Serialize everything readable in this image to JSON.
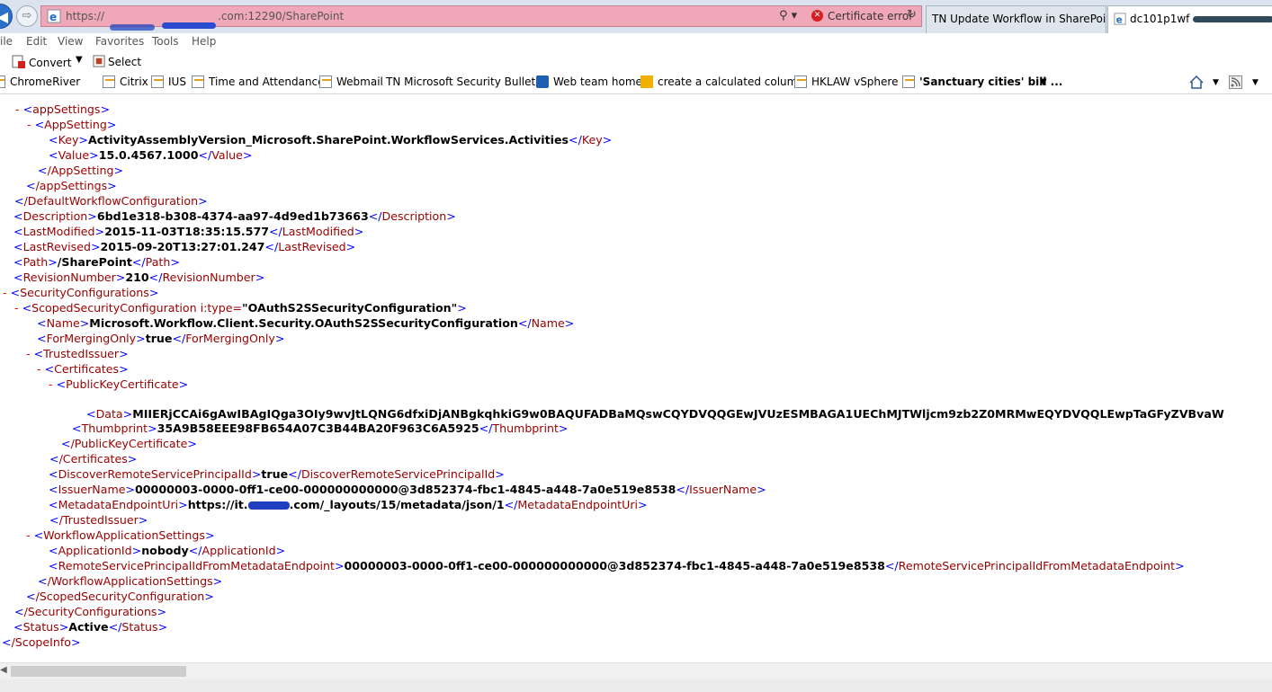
{
  "browser": {
    "address": {
      "protocol": "https://",
      "host_suffix": ".com:12290/SharePoint",
      "certificate_error": "Certificate error"
    },
    "tabs": [
      {
        "title": "TN Update Workflow in SharePoin..."
      },
      {
        "title": "dc101p1wf"
      }
    ],
    "menu": [
      "ile",
      "Edit",
      "View",
      "Favorites",
      "Tools",
      "Help"
    ],
    "commands": {
      "convert": "Convert",
      "select": "Select"
    },
    "favorites": [
      "ChromeRiver",
      "Citrix",
      "IUS",
      "Time and Attendance",
      "Webmail",
      "TN Microsoft Security Bulletin",
      "Web team home",
      "create a calculated colum...",
      "HKLAW vSphere",
      "'Sanctuary cities' bill ..."
    ],
    "colors": {
      "address_bar_error": "#f0a8b8",
      "xml_tag": "#990000",
      "xml_bracket": "#0000ff",
      "xml_toggle": "#ff0000"
    }
  },
  "xml": {
    "app_settings_open": "appSettings",
    "app_setting_open": "AppSetting",
    "key": {
      "tag": "Key",
      "value": "ActivityAssemblyVersion_Microsoft.SharePoint.WorkflowServices.Activities"
    },
    "value": {
      "tag": "Value",
      "value": "15.0.4567.1000"
    },
    "app_setting_close": "/AppSetting",
    "app_settings_close": "/appSettings",
    "default_workflow_close": "/DefaultWorkflowConfiguration",
    "description": {
      "tag": "Description",
      "value": "6bd1e318-b308-4374-aa97-4d9ed1b73663"
    },
    "last_modified": {
      "tag": "LastModified",
      "value": "2015-11-03T18:35:15.577"
    },
    "last_revised": {
      "tag": "LastRevised",
      "value": "2015-09-20T13:27:01.247"
    },
    "path": {
      "tag": "Path",
      "value": "/SharePoint"
    },
    "revision_number": {
      "tag": "RevisionNumber",
      "value": "210"
    },
    "security_configurations": "SecurityConfigurations",
    "scoped_security": {
      "tag": "ScopedSecurityConfiguration",
      "attr": " i:type=",
      "attr_value": "\"OAuthS2SSecurityConfiguration\""
    },
    "name": {
      "tag": "Name",
      "value": "Microsoft.Workflow.Client.Security.OAuthS2SSecurityConfiguration"
    },
    "for_merging_only": {
      "tag": "ForMergingOnly",
      "value": "true"
    },
    "trusted_issuer": "TrustedIssuer",
    "certificates": "Certificates",
    "public_key_certificate": "PublicKeyCertificate",
    "data": {
      "tag": "Data",
      "value": "MIIERjCCAi6gAwIBAgIQga3OIy9wvJtLQNG6dfxiDjANBgkqhkiG9w0BAQUFADBaMQswCQYDVQQGEwJVUzESMBAGA1UEChMJTWljcm9zb2Z0MRMwEQYDVQQLEwpTaGFyZVBvaW"
    },
    "thumbprint": {
      "tag": "Thumbprint",
      "value": "35A9B58EEE98FB654A07C3B44BA20F963C6A5925"
    },
    "public_key_certificate_close": "/PublicKeyCertificate",
    "certificates_close": "/Certificates",
    "discover": {
      "tag": "DiscoverRemoteServicePrincipalId",
      "value": "true"
    },
    "issuer_name": {
      "tag": "IssuerName",
      "value": "00000003-0000-0ff1-ce00-000000000000@3d852374-fbc1-4845-a448-7a0e519e8538"
    },
    "metadata_endpoint": {
      "tag": "MetadataEndpointUri",
      "value_prefix": "https://it.",
      "value_suffix": ".com/_layouts/15/metadata/json/1"
    },
    "trusted_issuer_close": "/TrustedIssuer",
    "workflow_app_settings": "WorkflowApplicationSettings",
    "application_id": {
      "tag": "ApplicationId",
      "value": "nobody"
    },
    "remote_service": {
      "tag": "RemoteServicePrincipalIdFromMetadataEndpoint",
      "value": "00000003-0000-0ff1-ce00-000000000000@3d852374-fbc1-4845-a448-7a0e519e8538"
    },
    "workflow_app_settings_close": "/WorkflowApplicationSettings",
    "scoped_security_close": "/ScopedSecurityConfiguration",
    "security_configurations_close": "/SecurityConfigurations",
    "status": {
      "tag": "Status",
      "value": "Active"
    },
    "scope_info_close": "/ScopeInfo"
  }
}
